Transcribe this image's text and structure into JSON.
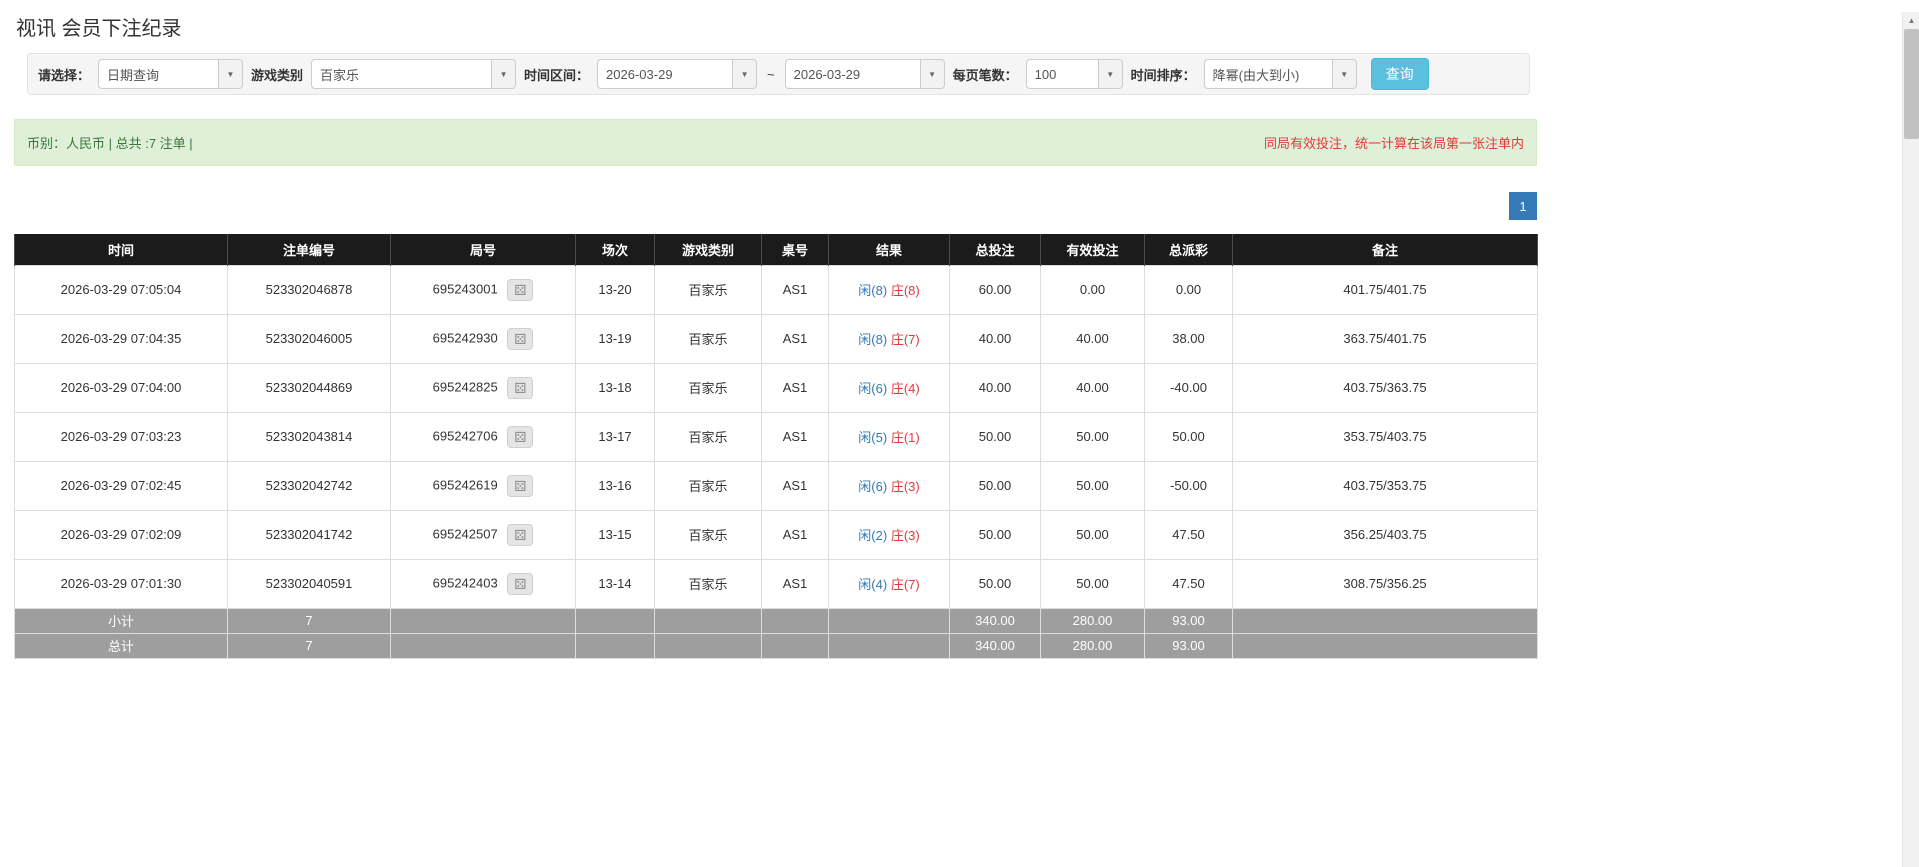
{
  "page_title": "视讯 会员下注纪录",
  "icons": {
    "dice": "⚄",
    "caret": "▼",
    "scroll_up": "▲"
  },
  "filters": {
    "select_label": "请选择：",
    "select_value": "日期查询",
    "game_type_label": "游戏类别",
    "game_type_value": "百家乐",
    "date_range_label": "时间区间：",
    "date_from": "2026-03-29",
    "tilde": "~",
    "date_to": "2026-03-29",
    "page_size_label": "每页笔数：",
    "page_size_value": "100",
    "sort_label": "时间排序：",
    "sort_value": "降幂(由大到小)",
    "search_button": "查询"
  },
  "summary": {
    "left_text": "币别：人民币 | 总共 :7 注单 |",
    "right_text": "同局有效投注，统一计算在该局第一张注单内"
  },
  "pagination": {
    "current": "1"
  },
  "table": {
    "headers": {
      "time": "时间",
      "bet_id": "注单编号",
      "round": "局号",
      "session": "场次",
      "game": "游戏类别",
      "table_no": "桌号",
      "result": "结果",
      "total_bet": "总投注",
      "valid_bet": "有效投注",
      "payout": "总派彩",
      "note": "备注"
    },
    "rows": [
      {
        "time": "2026-03-29 07:05:04",
        "bet_id": "523302046878",
        "round": "695243001",
        "session": "13-20",
        "game": "百家乐",
        "table_no": "AS1",
        "result_player": "闲(8)",
        "result_banker": "庄(8)",
        "total_bet": "60.00",
        "valid_bet": "0.00",
        "payout": "0.00",
        "note": "401.75/401.75"
      },
      {
        "time": "2026-03-29 07:04:35",
        "bet_id": "523302046005",
        "round": "695242930",
        "session": "13-19",
        "game": "百家乐",
        "table_no": "AS1",
        "result_player": "闲(8)",
        "result_banker": "庄(7)",
        "total_bet": "40.00",
        "valid_bet": "40.00",
        "payout": "38.00",
        "note": "363.75/401.75"
      },
      {
        "time": "2026-03-29 07:04:00",
        "bet_id": "523302044869",
        "round": "695242825",
        "session": "13-18",
        "game": "百家乐",
        "table_no": "AS1",
        "result_player": "闲(6)",
        "result_banker": "庄(4)",
        "total_bet": "40.00",
        "valid_bet": "40.00",
        "payout": "-40.00",
        "note": "403.75/363.75"
      },
      {
        "time": "2026-03-29 07:03:23",
        "bet_id": "523302043814",
        "round": "695242706",
        "session": "13-17",
        "game": "百家乐",
        "table_no": "AS1",
        "result_player": "闲(5)",
        "result_banker": "庄(1)",
        "total_bet": "50.00",
        "valid_bet": "50.00",
        "payout": "50.00",
        "note": "353.75/403.75"
      },
      {
        "time": "2026-03-29 07:02:45",
        "bet_id": "523302042742",
        "round": "695242619",
        "session": "13-16",
        "game": "百家乐",
        "table_no": "AS1",
        "result_player": "闲(6)",
        "result_banker": "庄(3)",
        "total_bet": "50.00",
        "valid_bet": "50.00",
        "payout": "-50.00",
        "note": "403.75/353.75"
      },
      {
        "time": "2026-03-29 07:02:09",
        "bet_id": "523302041742",
        "round": "695242507",
        "session": "13-15",
        "game": "百家乐",
        "table_no": "AS1",
        "result_player": "闲(2)",
        "result_banker": "庄(3)",
        "total_bet": "50.00",
        "valid_bet": "50.00",
        "payout": "47.50",
        "note": "356.25/403.75"
      },
      {
        "time": "2026-03-29 07:01:30",
        "bet_id": "523302040591",
        "round": "695242403",
        "session": "13-14",
        "game": "百家乐",
        "table_no": "AS1",
        "result_player": "闲(4)",
        "result_banker": "庄(7)",
        "total_bet": "50.00",
        "valid_bet": "50.00",
        "payout": "47.50",
        "note": "308.75/356.25"
      }
    ],
    "subtotal": {
      "label": "小计",
      "count": "7",
      "total_bet": "340.00",
      "valid_bet": "280.00",
      "payout": "93.00"
    },
    "total": {
      "label": "总计",
      "count": "7",
      "total_bet": "340.00",
      "valid_bet": "280.00",
      "payout": "93.00"
    }
  }
}
